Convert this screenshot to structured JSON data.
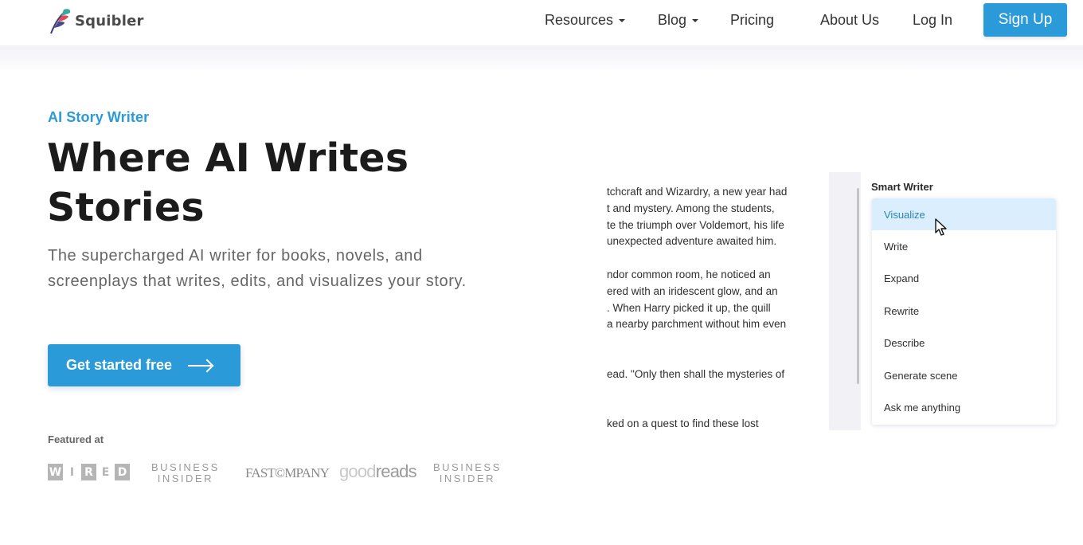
{
  "header": {
    "brand": "Squibler",
    "nav": [
      {
        "label": "Resources",
        "has_dropdown": true
      },
      {
        "label": "Blog",
        "has_dropdown": true
      },
      {
        "label": "Pricing",
        "has_dropdown": false
      },
      {
        "label": "About Us",
        "has_dropdown": false
      },
      {
        "label": "Log In",
        "has_dropdown": false
      }
    ],
    "signup_label": "Sign Up"
  },
  "hero": {
    "eyebrow": "AI Story Writer",
    "title_line1": "Where AI Writes",
    "title_line2": "Stories",
    "subtitle": "The supercharged AI writer for books, novels, and screenplays that writes, edits, and visualizes your story.",
    "cta_label": "Get started free",
    "cta_icon": "arrow-right-icon"
  },
  "featured": {
    "label": "Featured at",
    "logos": [
      {
        "name": "WIRED",
        "letters": [
          "W",
          "I",
          "R",
          "E",
          "D"
        ]
      },
      {
        "name": "Business Insider",
        "line1": "BUSINESS",
        "line2": "INSIDER"
      },
      {
        "name": "Fast Company",
        "text": "FAST©MPANY"
      },
      {
        "name": "goodreads",
        "part1": "good",
        "part2": "reads"
      },
      {
        "name": "Business Insider",
        "line1": "BUSINESS",
        "line2": "INSIDER"
      }
    ]
  },
  "editor": {
    "story_lines": [
      "tchcraft and Wizardry, a new year had",
      "t and mystery. Among the students,",
      "te the triumph over Voldemort, his life",
      "unexpected adventure awaited him.",
      "",
      "ndor common room, he noticed an",
      "ered with an iridescent glow, and an",
      ". When Harry picked it up, the quill",
      "a nearby parchment without him even",
      "",
      "",
      "ead. \"Only then shall the mysteries of",
      "",
      "",
      "ked on a quest to find these lost"
    ],
    "smart_writer": {
      "title": "Smart Writer",
      "items": [
        "Visualize",
        "Write",
        "Expand",
        "Rewrite",
        "Describe",
        "Generate scene",
        "Ask me anything"
      ],
      "active_item": "Visualize"
    }
  },
  "colors": {
    "accent": "#2a9bd8",
    "menu_active_bg": "#dbeefd",
    "menu_active_text": "#2b82b9",
    "heading": "#1b1b1b"
  }
}
